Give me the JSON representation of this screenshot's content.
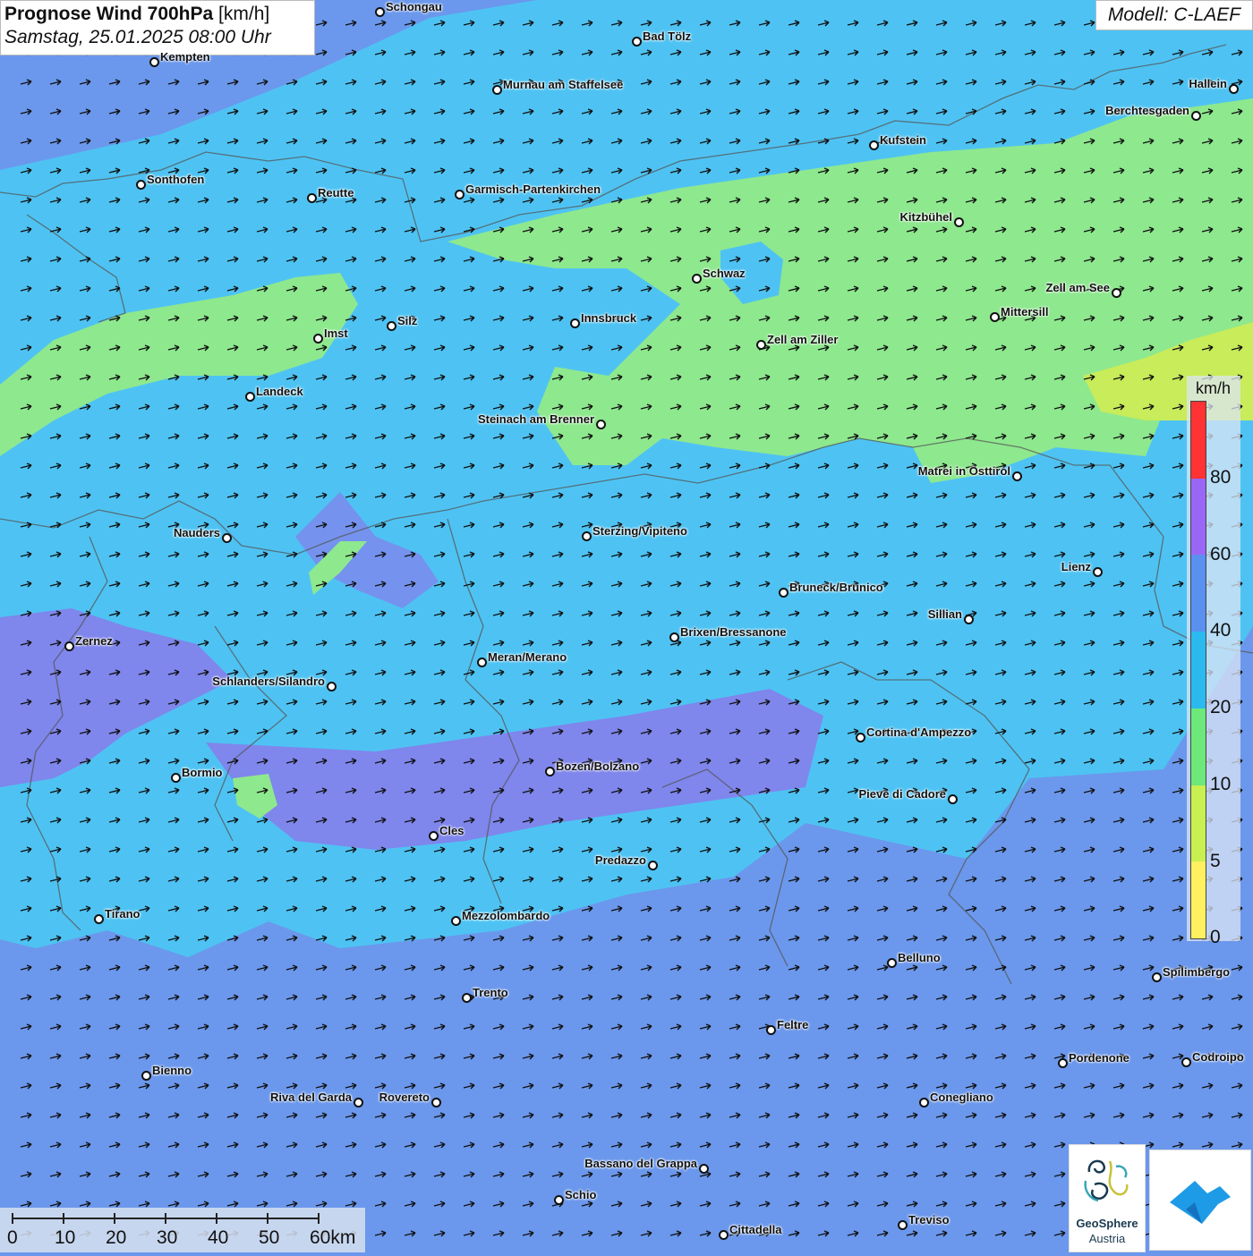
{
  "title": {
    "main": "Prognose Wind 700hPa",
    "unit": "[km/h]",
    "date": "Samstag, 25.01.2025 08:00 Uhr"
  },
  "model": "Modell: C-LAEF",
  "legend": {
    "unit": "km/h",
    "ticks": [
      "80",
      "60",
      "40",
      "20",
      "10",
      "5",
      "0"
    ],
    "colors": [
      "#ff3333",
      "#9a66f5",
      "#5a90f0",
      "#2bbaf0",
      "#6de87a",
      "#c8f050",
      "#fff060"
    ]
  },
  "scalebar": {
    "labels": [
      "0",
      "10",
      "20",
      "30",
      "40",
      "50",
      "60km"
    ]
  },
  "logos": {
    "geosphere_line1": "GeoSphere",
    "geosphere_line2": "Austria"
  },
  "colors": {
    "ocean_blue": "#6b98ec",
    "light_blue": "#4ec3f3",
    "green": "#8ee88e",
    "yellow_green": "#c8ec5a",
    "violet": "#8c88ec",
    "arrow": "#111111"
  },
  "wind_direction": "from west-southwest",
  "cities": [
    {
      "name": "Schongau"
    },
    {
      "name": "Bad Tölz"
    },
    {
      "name": "Kempten"
    },
    {
      "name": "Murnau am Staffelsee"
    },
    {
      "name": "Hallein"
    },
    {
      "name": "Berchtesgaden"
    },
    {
      "name": "Kufstein"
    },
    {
      "name": "Sonthofen"
    },
    {
      "name": "Reutte"
    },
    {
      "name": "Garmisch-Partenkirchen"
    },
    {
      "name": "Kitzbühel"
    },
    {
      "name": "Schwaz"
    },
    {
      "name": "Zell am See"
    },
    {
      "name": "Mittersill"
    },
    {
      "name": "Innsbruck"
    },
    {
      "name": "Silz"
    },
    {
      "name": "Imst"
    },
    {
      "name": "Zell am Ziller"
    },
    {
      "name": "Landeck"
    },
    {
      "name": "Steinach am Brenner"
    },
    {
      "name": "Matrei in Osttirol"
    },
    {
      "name": "Nauders"
    },
    {
      "name": "Sterzing/Vipiteno"
    },
    {
      "name": "Lienz"
    },
    {
      "name": "Bruneck/Brunico"
    },
    {
      "name": "Sillian"
    },
    {
      "name": "Brixen/Bressanone"
    },
    {
      "name": "Zernez"
    },
    {
      "name": "Meran/Merano"
    },
    {
      "name": "Schlanders/Silandro"
    },
    {
      "name": "Cortina d'Ampezzo"
    },
    {
      "name": "Bozen/Bolzano"
    },
    {
      "name": "Bormio"
    },
    {
      "name": "Pieve di Cadore"
    },
    {
      "name": "Cles"
    },
    {
      "name": "Predazzo"
    },
    {
      "name": "Tirano"
    },
    {
      "name": "Mezzolombardo"
    },
    {
      "name": "Belluno"
    },
    {
      "name": "Spilimbergo"
    },
    {
      "name": "Trento"
    },
    {
      "name": "Feltre"
    },
    {
      "name": "Pordenone"
    },
    {
      "name": "Codroipo"
    },
    {
      "name": "Bienno"
    },
    {
      "name": "Riva del Garda"
    },
    {
      "name": "Rovereto"
    },
    {
      "name": "Conegliano"
    },
    {
      "name": "Bassano del Grappa"
    },
    {
      "name": "Schio"
    },
    {
      "name": "Treviso"
    },
    {
      "name": "Cittadella"
    }
  ]
}
